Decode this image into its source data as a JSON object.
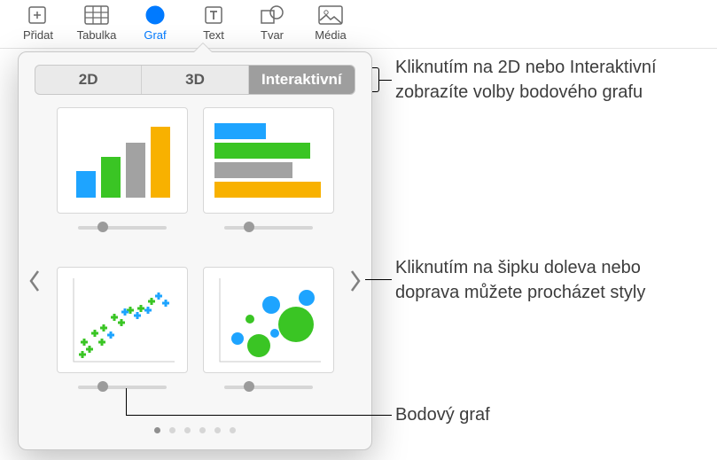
{
  "toolbar": {
    "add": "Přidat",
    "table": "Tabulka",
    "chart": "Graf",
    "text": "Text",
    "shape": "Tvar",
    "media": "Média"
  },
  "segments": {
    "two_d": "2D",
    "three_d": "3D",
    "interactive": "Interaktivní"
  },
  "callouts": {
    "tabs": "Kliknutím na 2D nebo Interaktivní zobrazíte volby bodového grafu",
    "arrows": "Kliknutím na šipku doleva nebo doprava můžete procházet styly",
    "scatter": "Bodový graf"
  },
  "pager": {
    "dots": 6,
    "active_index": 0
  }
}
